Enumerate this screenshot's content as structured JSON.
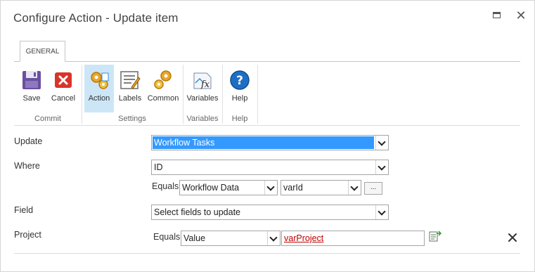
{
  "window": {
    "title": "Configure Action - Update item",
    "maximize_icon": "maximize-icon",
    "close_glyph": "✕"
  },
  "ribbon": {
    "tab_label": "GENERAL",
    "groups": {
      "commit": "Commit",
      "settings": "Settings",
      "variables": "Variables",
      "help": "Help"
    },
    "buttons": {
      "save": "Save",
      "cancel": "Cancel",
      "action": "Action",
      "labels": "Labels",
      "common": "Common",
      "variables": "Variables",
      "help": "Help"
    },
    "selected_button": "Action"
  },
  "form": {
    "update": {
      "label": "Update",
      "value": "Workflow Tasks"
    },
    "where": {
      "label": "Where",
      "field_value": "ID",
      "equals_label": "Equals",
      "source_value": "Workflow Data",
      "variable_value": "varId",
      "ellipsis": "..."
    },
    "field": {
      "label": "Field",
      "value": "Select fields to update"
    },
    "project": {
      "label": "Project",
      "equals_label": "Equals",
      "type_value": "Value",
      "value_text": "varProject"
    }
  },
  "colors": {
    "selection_highlight": "#3399ff",
    "selected_ribbon_button": "#cde6f7",
    "variable_link": "#c00000"
  }
}
